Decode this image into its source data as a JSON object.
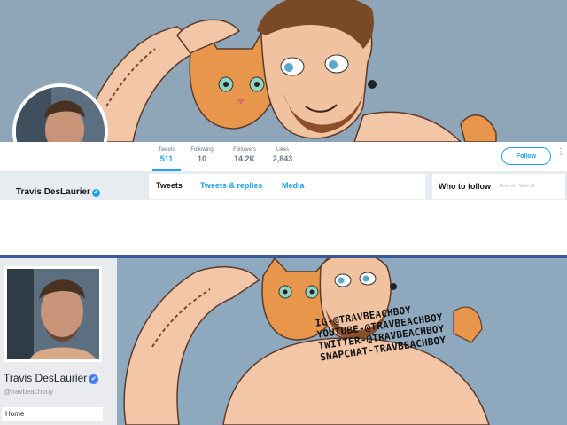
{
  "twitter": {
    "profile_name": "Travis DesLaurier",
    "stats": [
      {
        "label": "Tweets",
        "value": "511"
      },
      {
        "label": "Following",
        "value": "10"
      },
      {
        "label": "Followers",
        "value": "14.2K"
      },
      {
        "label": "Likes",
        "value": "2,843"
      }
    ],
    "follow_label": "Follow",
    "tabs": [
      "Tweets",
      "Tweets & replies",
      "Media"
    ],
    "who_to_follow": "Who to follow",
    "who_links": "Refresh · View all",
    "verified_glyph": "✔",
    "more_glyph": "⋮"
  },
  "facebook": {
    "profile_name": "Travis DesLaurier",
    "handle": "@travbeachboy",
    "home_label": "Home",
    "verified_glyph": "✔",
    "social_lines": [
      "IG-@TRAVBEACHBOY",
      "YOUTUBE-@TRAVBEACHBOY",
      "TWITTER-@TRAVBEACHBOY",
      "SNAPCHAT-TRAVBEACHBOY"
    ]
  },
  "colors": {
    "twitter_blue": "#1da1f2",
    "facebook_blue": "#3b5998",
    "banner_blue": "#8fa6b8"
  }
}
